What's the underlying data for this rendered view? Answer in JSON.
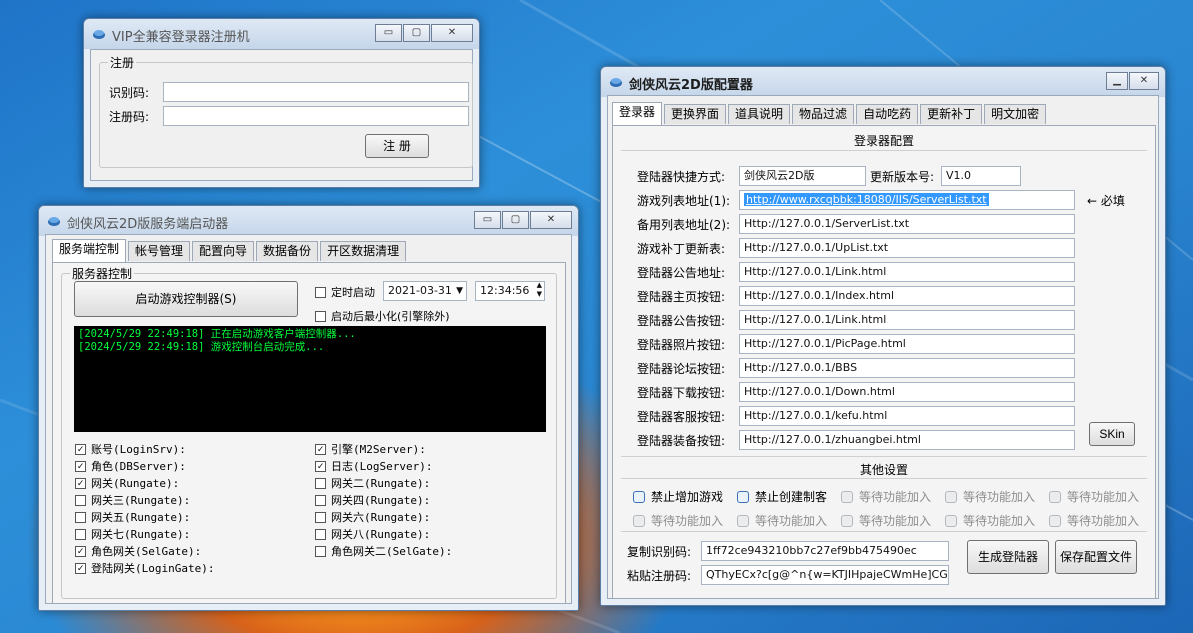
{
  "window_reg": {
    "title": "VIP全兼容登录器注册机",
    "group_title": "注册",
    "id_label": "识别码:",
    "id_value": "",
    "reg_label": "注册码:",
    "reg_value": "",
    "register_button": "注 册"
  },
  "window_server": {
    "title": "剑侠风云2D版服务端启动器",
    "tabs": [
      "服务端控制",
      "帐号管理",
      "配置向导",
      "数据备份",
      "开区数据清理"
    ],
    "group_title": "服务器控制",
    "start_button": "启动游戏控制器(S)",
    "timer_label": "定时启动",
    "timer_date": "2021-03-31",
    "timer_time": "12:34:56",
    "minimize_label": "启动后最小化(引擎除外)",
    "log": [
      "[2024/5/29 22:49:18] 正在启动游戏客户端控制器...",
      "[2024/5/29 22:49:18] 游戏控制台启动完成..."
    ],
    "components_left": [
      {
        "label": "账号(LoginSrv):",
        "checked": true
      },
      {
        "label": "角色(DBServer):",
        "checked": true
      },
      {
        "label": "网关(Rungate):",
        "checked": true
      },
      {
        "label": "网关三(Rungate):",
        "checked": false
      },
      {
        "label": "网关五(Rungate):",
        "checked": false
      },
      {
        "label": "网关七(Rungate):",
        "checked": false
      },
      {
        "label": "角色网关(SelGate):",
        "checked": true
      },
      {
        "label": "登陆网关(LoginGate):",
        "checked": true
      }
    ],
    "components_right": [
      {
        "label": "引擎(M2Server):",
        "checked": true
      },
      {
        "label": "日志(LogServer):",
        "checked": true
      },
      {
        "label": "网关二(Rungate):",
        "checked": false
      },
      {
        "label": "网关四(Rungate):",
        "checked": false
      },
      {
        "label": "网关六(Rungate):",
        "checked": false
      },
      {
        "label": "网关八(Rungate):",
        "checked": false
      },
      {
        "label": "角色网关二(SelGate):",
        "checked": false
      }
    ]
  },
  "window_config": {
    "title": "剑侠风云2D版配置器",
    "tabs": [
      "登录器",
      "更换界面",
      "道具说明",
      "物品过滤",
      "自动吃药",
      "更新补丁",
      "明文加密"
    ],
    "section_title": "登录器配置",
    "shortcut_label": "登陆器快捷方式:",
    "shortcut_value": "剑侠风云2D版",
    "version_label": "更新版本号:",
    "version_value": "V1.0",
    "required_note": "← 必填",
    "fields": [
      {
        "label": "游戏列表地址(1):",
        "value": "http://www.rxcqbbk:18080/IIS/ServerList.txt"
      },
      {
        "label": "备用列表地址(2):",
        "value": "Http://127.0.0.1/ServerList.txt"
      },
      {
        "label": "游戏补丁更新表:",
        "value": "Http://127.0.0.1/UpList.txt"
      },
      {
        "label": "登陆器公告地址:",
        "value": "Http://127.0.0.1/Link.html"
      },
      {
        "label": "登陆器主页按钮:",
        "value": "Http://127.0.0.1/Index.html"
      },
      {
        "label": "登陆器公告按钮:",
        "value": "Http://127.0.0.1/Link.html"
      },
      {
        "label": "登陆器照片按钮:",
        "value": "Http://127.0.0.1/PicPage.html"
      },
      {
        "label": "登陆器论坛按钮:",
        "value": "Http://127.0.0.1/BBS"
      },
      {
        "label": "登陆器下载按钮:",
        "value": "Http://127.0.0.1/Down.html"
      },
      {
        "label": "登陆器客服按钮:",
        "value": "Http://127.0.0.1/kefu.html"
      },
      {
        "label": "登陆器装备按钮:",
        "value": "Http://127.0.0.1/zhuangbei.html"
      }
    ],
    "skin_button": "SKin",
    "other_title": "其他设置",
    "options_row1": [
      {
        "label": "禁止增加游戏",
        "enabled": true
      },
      {
        "label": "禁止创建制客",
        "enabled": true
      },
      {
        "label": "等待功能加入",
        "enabled": false
      },
      {
        "label": "等待功能加入",
        "enabled": false
      },
      {
        "label": "等待功能加入",
        "enabled": false
      }
    ],
    "options_row2": [
      {
        "label": "等待功能加入",
        "enabled": false
      },
      {
        "label": "等待功能加入",
        "enabled": false
      },
      {
        "label": "等待功能加入",
        "enabled": false
      },
      {
        "label": "等待功能加入",
        "enabled": false
      },
      {
        "label": "等待功能加入",
        "enabled": false
      }
    ],
    "copy_label": "复制识别码:",
    "copy_value": "1ff72ce943210bb7c27ef9bb475490ec",
    "paste_label": "粘贴注册码:",
    "paste_value": "QThyECx?c[g@^n{w=KTJIHpajeCWmHe]CGvyEhı",
    "generate_button": "生成登陆器",
    "save_button": "保存配置文件"
  },
  "colors": {
    "accent": "#3399ff",
    "console_text": "#00ff3c",
    "desktop": "#2a86d1"
  }
}
